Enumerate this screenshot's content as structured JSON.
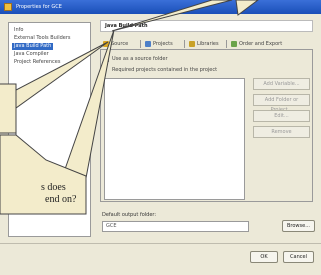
{
  "window": {
    "title": "Properties for GCE"
  },
  "left_pane": {
    "items": [
      {
        "label": "Info",
        "selected": false
      },
      {
        "label": "External Tools Builders",
        "selected": false
      },
      {
        "label": "Java Build Path",
        "selected": true
      },
      {
        "label": "Java Compiler",
        "selected": false
      },
      {
        "label": "Project References",
        "selected": false
      }
    ]
  },
  "right_pane": {
    "header": "Java Build Path",
    "tabs": [
      {
        "label": "Source",
        "icon": "source-folder-icon",
        "color": "#d9a521"
      },
      {
        "label": "Projects",
        "icon": "project-icon",
        "color": "#4d7fc8"
      },
      {
        "label": "Libraries",
        "icon": "library-icon",
        "color": "#c9a227"
      },
      {
        "label": "Order and Export",
        "icon": "order-icon",
        "color": "#6aa34a"
      }
    ],
    "checkbox_top": "Use as a source folder",
    "checkbox_list": "Required projects contained in the project",
    "side_buttons": [
      "Add Variable...",
      "Add Folder or Project...",
      "Edit...",
      "Remove"
    ],
    "output_label": "Default output folder:",
    "output_value": "GCE",
    "browse_label": "Browse..."
  },
  "footer": {
    "ok_label": "OK",
    "cancel_label": "Cancel"
  },
  "callout": {
    "line1": "s does",
    "line2": "end on?"
  }
}
